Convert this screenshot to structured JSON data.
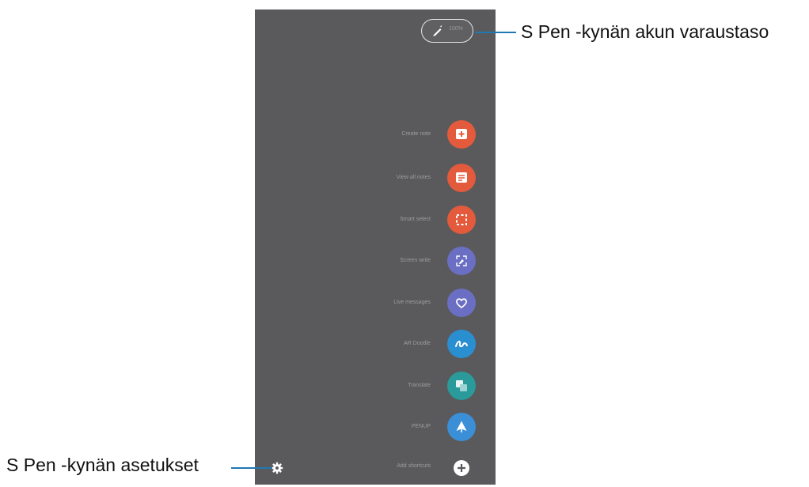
{
  "battery": {
    "percent_label": "100%"
  },
  "menu_items": [
    {
      "label": "Create note",
      "color": "#e35a3c",
      "icon": "note-plus-icon"
    },
    {
      "label": "View all notes",
      "color": "#e35a3c",
      "icon": "notes-list-icon"
    },
    {
      "label": "Smart select",
      "color": "#e35a3c",
      "icon": "smart-select-icon"
    },
    {
      "label": "Screen write",
      "color": "#6b6fc4",
      "icon": "screen-write-icon"
    },
    {
      "label": "Live messages",
      "color": "#6b6fc4",
      "icon": "heart-icon"
    },
    {
      "label": "AR Doodle",
      "color": "#2a8fd0",
      "icon": "doodle-icon"
    },
    {
      "label": "Translate",
      "color": "#2a9a9a",
      "icon": "translate-icon"
    },
    {
      "label": "PENUP",
      "color": "#3a8fd6",
      "icon": "penup-icon"
    }
  ],
  "add_shortcuts_label": "Add shortcuts",
  "callouts": {
    "battery": "S Pen -kynän akun varaustaso",
    "settings": "S Pen -kynän asetukset"
  }
}
